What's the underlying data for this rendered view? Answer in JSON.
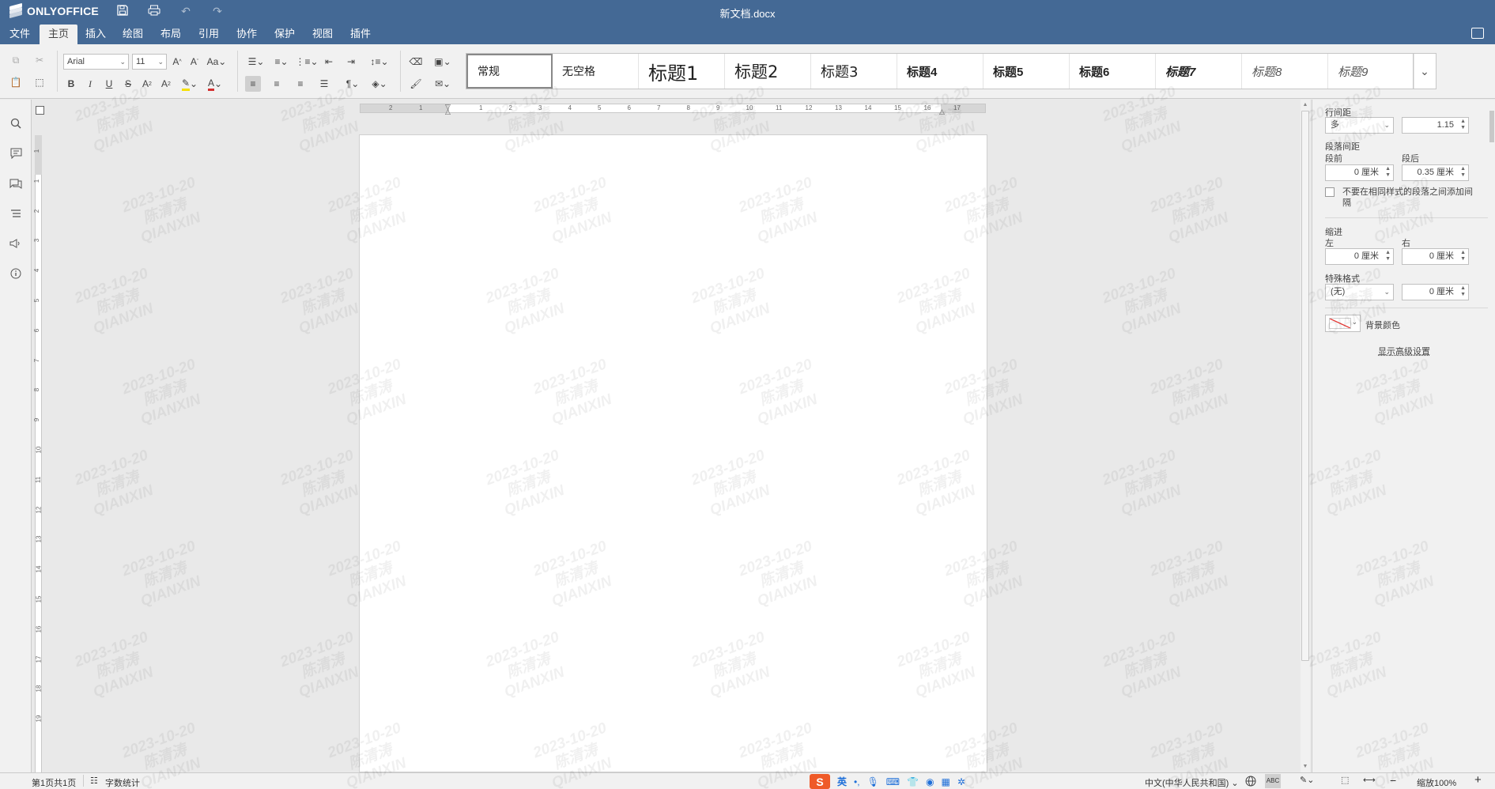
{
  "app": {
    "name": "ONLYOFFICE",
    "doc_title": "新文档.docx"
  },
  "menu": {
    "tabs": [
      "文件",
      "主页",
      "插入",
      "绘图",
      "布局",
      "引用",
      "协作",
      "保护",
      "视图",
      "插件"
    ],
    "active": "主页"
  },
  "toolbar": {
    "font_name": "Arial",
    "font_size": "11",
    "styles": [
      "常规",
      "无空格",
      "标题1",
      "标题2",
      "标题3",
      "标题4",
      "标题5",
      "标题6",
      "标题7",
      "标题8",
      "标题9"
    ],
    "active_style": "常规"
  },
  "ruler": {
    "h_numbers": [
      "2",
      "1",
      "1",
      "2",
      "3",
      "4",
      "5",
      "6",
      "7",
      "8",
      "9",
      "10",
      "11",
      "12",
      "13",
      "14",
      "15",
      "16",
      "17"
    ],
    "v_numbers": [
      "1",
      "1",
      "2",
      "3",
      "4",
      "5",
      "6",
      "7",
      "8",
      "9",
      "10",
      "11",
      "12",
      "13",
      "14",
      "15",
      "16",
      "17",
      "18",
      "19"
    ]
  },
  "right_panel": {
    "line_spacing_label": "行间距",
    "line_spacing_type": "多",
    "line_spacing_value": "1.15",
    "para_spacing_label": "段落间距",
    "before_label": "段前",
    "before_value": "0 厘米",
    "after_label": "段后",
    "after_value": "0.35 厘米",
    "dont_add_interval": "不要在相同样式的段落之间添加间隔",
    "indent_label": "缩进",
    "left_label": "左",
    "left_value": "0 厘米",
    "right_label": "右",
    "right_value": "0 厘米",
    "special_label": "特殊格式",
    "special_value": "(无)",
    "special_amount": "0 厘米",
    "background_color_label": "背景颜色",
    "advanced_settings": "显示高级设置"
  },
  "statusbar": {
    "page_info": "第1页共1页",
    "word_count": "字数统计",
    "language": "中文(中华人民共和国)",
    "zoom": "缩放100%",
    "ime_lang": "英"
  },
  "watermark": {
    "date": "2023-10-20",
    "name": "陈清涛",
    "org": "QIANXIN"
  }
}
